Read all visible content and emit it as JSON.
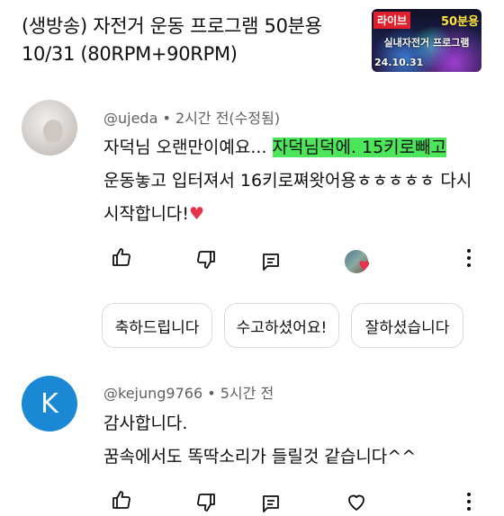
{
  "video": {
    "title_line1": "(생방송) 자전거 운동 프로그램 50분용",
    "title_line2": "10/31  (80RPM+90RPM)",
    "thumbnail": {
      "live_badge": "라이브",
      "duration_text": "50분용",
      "caption": "실내자전거 프로그램",
      "date": "24.10.31"
    }
  },
  "comments": [
    {
      "author": "@ujeda",
      "time": "2시간 전(수정됨)",
      "text_plain": "자덕님 오랜만이예요...",
      "text_highlight": "자덕님덕에. 15키로빼고",
      "text_line2": "운동놓고 입터져서 16키로쪄왓어용ㅎㅎㅎㅎㅎ 다시",
      "text_line3": "시작합니다!",
      "emoji": "♥"
    },
    {
      "author": "@kejung9766",
      "time": "5시간 전",
      "avatar_letter": "K",
      "text_line1": "감사합니다.",
      "text_line2": "꿈속에서도 똑딱소리가 들릴것 같습니다^^"
    }
  ],
  "suggested_replies": [
    "축하드립니다",
    "수고하셨어요!",
    "잘하셨습니다"
  ],
  "separator": " • ",
  "icons": {
    "like": "thumbs-up-icon",
    "dislike": "thumbs-down-icon",
    "reply": "comment-icon",
    "more": "more-vert-icon",
    "creator_heart": "heart-icon"
  },
  "colors": {
    "highlight": "#4de65a",
    "heart": "#e8314a",
    "avatar_k": "#1a88d4",
    "live_badge": "#e0202a"
  }
}
